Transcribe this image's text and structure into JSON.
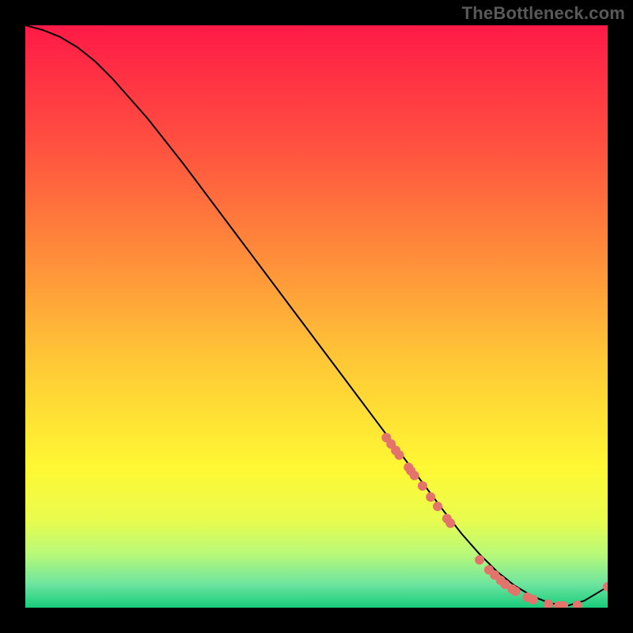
{
  "watermark": "TheBottleneck.com",
  "chart_data": {
    "type": "line",
    "title": "",
    "xlabel": "",
    "ylabel": "",
    "xlim": [
      0,
      100
    ],
    "ylim": [
      0,
      100
    ],
    "grid": false,
    "legend": false,
    "series": [
      {
        "name": "curve",
        "style": "line",
        "color": "#000000",
        "x": [
          0,
          3,
          6,
          9,
          12,
          15,
          18,
          21,
          24,
          27,
          30,
          33,
          36,
          39,
          42,
          45,
          48,
          51,
          54,
          57,
          60,
          63,
          66,
          69,
          72,
          75,
          78,
          81,
          84,
          87,
          90,
          93,
          96,
          99,
          100
        ],
        "y": [
          100,
          99.2,
          98.0,
          96.2,
          93.8,
          90.8,
          87.4,
          84.0,
          80.2,
          76.4,
          72.4,
          68.4,
          64.4,
          60.4,
          56.4,
          52.4,
          48.4,
          44.4,
          40.4,
          36.4,
          32.4,
          28.4,
          24.4,
          20.4,
          16.4,
          12.6,
          9.2,
          6.2,
          3.8,
          2.0,
          0.8,
          0.3,
          1.2,
          3.0,
          3.6
        ]
      },
      {
        "name": "points",
        "style": "scatter",
        "color": "#E4736B",
        "x": [
          62.0,
          62.8,
          63.6,
          64.2,
          65.8,
          66.2,
          66.8,
          68.2,
          69.6,
          70.8,
          72.4,
          73.0,
          78.0,
          79.6,
          80.6,
          81.6,
          82.4,
          83.6,
          84.2,
          86.2,
          87.2,
          89.8,
          91.6,
          92.4,
          94.8,
          100.0
        ],
        "y": [
          29.2,
          28.1,
          27.0,
          26.2,
          24.1,
          23.5,
          22.7,
          20.9,
          19.0,
          17.4,
          15.3,
          14.5,
          8.2,
          6.5,
          5.6,
          4.7,
          4.0,
          3.2,
          2.8,
          1.8,
          1.4,
          0.6,
          0.3,
          0.3,
          0.4,
          3.6
        ]
      }
    ],
    "background_gradient": {
      "stops": [
        {
          "offset": 0.0,
          "color": "#FF1A47"
        },
        {
          "offset": 0.2,
          "color": "#FF4F40"
        },
        {
          "offset": 0.4,
          "color": "#FF8E3A"
        },
        {
          "offset": 0.58,
          "color": "#FFC936"
        },
        {
          "offset": 0.76,
          "color": "#FFF833"
        },
        {
          "offset": 0.85,
          "color": "#E8FC4E"
        },
        {
          "offset": 0.91,
          "color": "#B6F97A"
        },
        {
          "offset": 0.96,
          "color": "#6CE4A0"
        },
        {
          "offset": 1.0,
          "color": "#19CC7A"
        }
      ]
    }
  }
}
